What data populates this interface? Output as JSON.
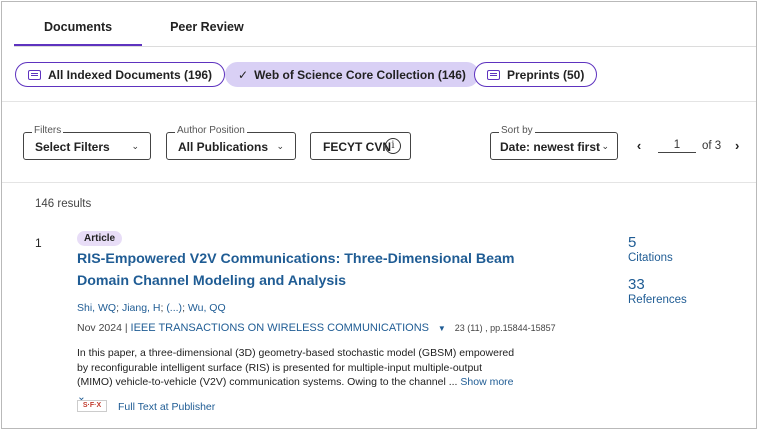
{
  "tabs": [
    {
      "label": "Documents",
      "active": true
    },
    {
      "label": "Peer Review",
      "active": false
    }
  ],
  "collections": {
    "all_indexed": "All Indexed Documents (196)",
    "wos_core": "Web of Science Core Collection (146)",
    "preprints": "Preprints (50)"
  },
  "filters": {
    "filters_legend": "Filters",
    "filters_value": "Select Filters",
    "author_legend": "Author Position",
    "author_value": "All Publications",
    "fecyt_label": "FECYT CVN",
    "sort_legend": "Sort by",
    "sort_value": "Date: newest first"
  },
  "pager": {
    "page": "1",
    "of_label": "of 3"
  },
  "results": {
    "count_text": "146 results",
    "items": [
      {
        "index": "1",
        "type": "Article",
        "title": "RIS-Empowered V2V Communications: Three-Dimensional Beam Domain Channel Modeling and Analysis",
        "authors": [
          "Shi, WQ",
          "Jiang, H",
          "(...)",
          "Wu, QQ"
        ],
        "date": "Nov 2024",
        "journal": "IEEE TRANSACTIONS ON WIRELESS COMMUNICATIONS",
        "volume": "23 (11) , pp.15844-15857",
        "abstract": "In this paper, a three-dimensional (3D) geometry-based stochastic model (GBSM) empowered by reconfigurable intelligent surface (RIS) is presented for multiple-input multiple-output (MIMO) vehicle-to-vehicle (V2V) communication systems. Owing to the channel ...",
        "show_more": "Show more",
        "full_text": "Full Text at Publisher",
        "sfx_label": "S·F·X",
        "citations_count": "5",
        "citations_label": "Citations",
        "references_count": "33",
        "references_label": "References"
      }
    ]
  },
  "colors": {
    "accent": "#5e33bf",
    "link": "#1f5c94",
    "chip_fill": "#d9d0f5",
    "badge_fill": "#e8ddf7"
  }
}
